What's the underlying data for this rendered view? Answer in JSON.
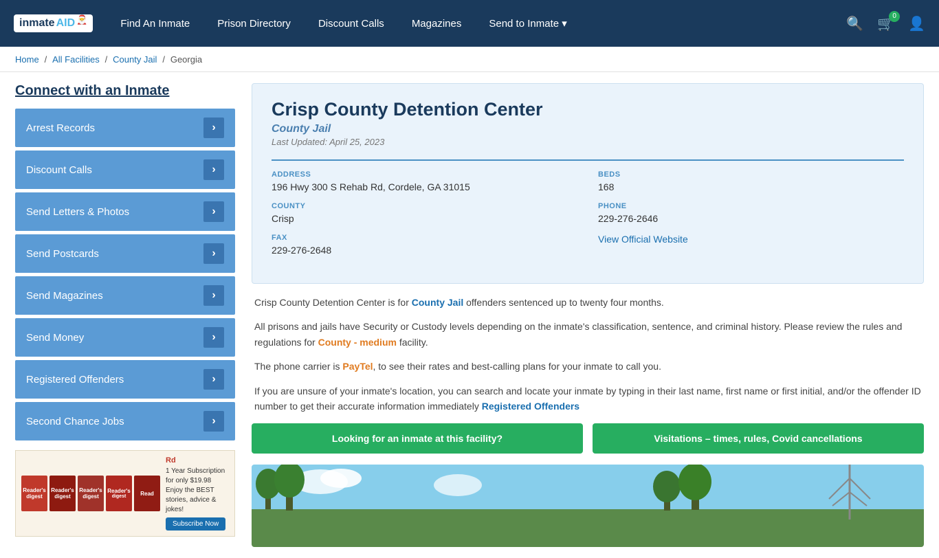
{
  "header": {
    "logo_main": "inmate",
    "logo_suffix": "AID",
    "nav": [
      {
        "label": "Find An Inmate",
        "id": "find-inmate"
      },
      {
        "label": "Prison Directory",
        "id": "prison-directory"
      },
      {
        "label": "Discount Calls",
        "id": "discount-calls"
      },
      {
        "label": "Magazines",
        "id": "magazines"
      },
      {
        "label": "Send to Inmate ▾",
        "id": "send-to-inmate"
      }
    ],
    "cart_count": "0"
  },
  "breadcrumb": {
    "home": "Home",
    "all_facilities": "All Facilities",
    "county_jail": "County Jail",
    "state": "Georgia"
  },
  "sidebar": {
    "title": "Connect with an Inmate",
    "items": [
      {
        "label": "Arrest Records",
        "id": "arrest-records"
      },
      {
        "label": "Discount Calls",
        "id": "discount-calls"
      },
      {
        "label": "Send Letters & Photos",
        "id": "send-letters"
      },
      {
        "label": "Send Postcards",
        "id": "send-postcards"
      },
      {
        "label": "Send Magazines",
        "id": "send-magazines"
      },
      {
        "label": "Send Money",
        "id": "send-money"
      },
      {
        "label": "Registered Offenders",
        "id": "registered-offenders"
      },
      {
        "label": "Second Chance Jobs",
        "id": "second-chance-jobs"
      }
    ]
  },
  "ad": {
    "mag_label": "Rd",
    "offer_line1": "1 Year Subscription for only $19.98",
    "offer_line2": "Enjoy the BEST stories, advice & jokes!",
    "subscribe_label": "Subscribe Now"
  },
  "facility": {
    "name": "Crisp County Detention Center",
    "type": "County Jail",
    "last_updated": "Last Updated: April 25, 2023",
    "address_label": "ADDRESS",
    "address_value": "196 Hwy 300 S Rehab Rd, Cordele, GA 31015",
    "beds_label": "BEDS",
    "beds_value": "168",
    "county_label": "COUNTY",
    "county_value": "Crisp",
    "phone_label": "PHONE",
    "phone_value": "229-276-2646",
    "fax_label": "FAX",
    "fax_value": "229-276-2648",
    "website_label": "View Official Website",
    "desc1": "Crisp County Detention Center is for County Jail offenders sentenced up to twenty four months.",
    "desc2": "All prisons and jails have Security or Custody levels depending on the inmate's classification, sentence, and criminal history. Please review the rules and regulations for County - medium facility.",
    "desc3": "The phone carrier is PayTel, to see their rates and best-calling plans for your inmate to call you.",
    "desc4": "If you are unsure of your inmate's location, you can search and locate your inmate by typing in their last name, first name or first initial, and/or the offender ID number to get their accurate information immediately Registered Offenders",
    "btn1": "Looking for an inmate at this facility?",
    "btn2": "Visitations – times, rules, Covid cancellations"
  }
}
